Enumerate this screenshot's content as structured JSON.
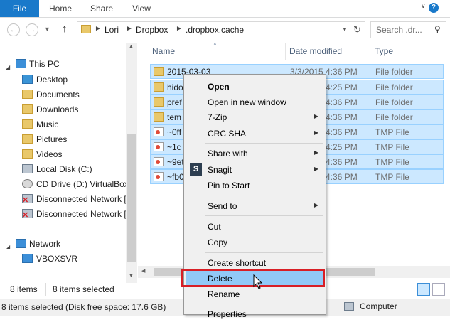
{
  "ribbon": {
    "tabs": [
      "File",
      "Home",
      "Share",
      "View"
    ],
    "help": "?"
  },
  "address": {
    "crumbs": [
      "Lori",
      "Dropbox",
      ".dropbox.cache"
    ],
    "search_placeholder": "Search .dr..."
  },
  "nav": {
    "this_pc": "This PC",
    "items": [
      "Desktop",
      "Documents",
      "Downloads",
      "Music",
      "Pictures",
      "Videos",
      "Local Disk (C:)",
      "CD Drive (D:) VirtualBox",
      "Disconnected Network [",
      "Disconnected Network ["
    ],
    "network": "Network",
    "network_items": [
      "VBOXSVR"
    ]
  },
  "list": {
    "columns": {
      "name": "Name",
      "date": "Date modified",
      "type": "Type"
    },
    "rows": [
      {
        "name": "2015-03-03",
        "date": "3/3/2015 4:36 PM",
        "type": "File folder",
        "icon": "folder-icon"
      },
      {
        "name": "hido",
        "date": "4:25 PM",
        "type": "File folder",
        "icon": "folder-icon"
      },
      {
        "name": "pref",
        "date": "4:36 PM",
        "type": "File folder",
        "icon": "folder-icon"
      },
      {
        "name": "tem",
        "date": "4:36 PM",
        "type": "File folder",
        "icon": "folder-icon"
      },
      {
        "name": "~0ff",
        "date": "4:36 PM",
        "type": "TMP File",
        "icon": "tmp-file-icon"
      },
      {
        "name": "~1c",
        "date": "4:25 PM",
        "type": "TMP File",
        "icon": "tmp-file-icon"
      },
      {
        "name": "~9et",
        "date": "4:36 PM",
        "type": "TMP File",
        "icon": "tmp-file-icon"
      },
      {
        "name": "~fb0",
        "date": "4:36 PM",
        "type": "TMP File",
        "icon": "tmp-file-icon"
      }
    ]
  },
  "status": {
    "count": "8 items",
    "selected": "8 items selected",
    "bottom_left": "8 items selected (Disk free space: 17.6 GB)",
    "bottom_right": "Computer"
  },
  "menu": {
    "items": [
      {
        "label": "Open",
        "bold": true
      },
      {
        "label": "Open in new window"
      },
      {
        "label": "7-Zip",
        "submenu": true
      },
      {
        "label": "CRC SHA",
        "submenu": true
      },
      {
        "label": "Share with",
        "submenu": true
      },
      {
        "label": "Snagit",
        "submenu": true
      },
      {
        "label": "Pin to Start"
      },
      {
        "label": "Send to",
        "submenu": true
      },
      {
        "label": "Cut"
      },
      {
        "label": "Copy"
      },
      {
        "label": "Create shortcut"
      },
      {
        "label": "Delete",
        "highlighted": true
      },
      {
        "label": "Rename"
      },
      {
        "label": "Properties"
      }
    ],
    "submenu_arrow": "▶",
    "snagit_badge": "S"
  },
  "colors": {
    "accent": "#1979ca",
    "selection": "#cce8ff",
    "highlight_border": "#d81f26"
  }
}
